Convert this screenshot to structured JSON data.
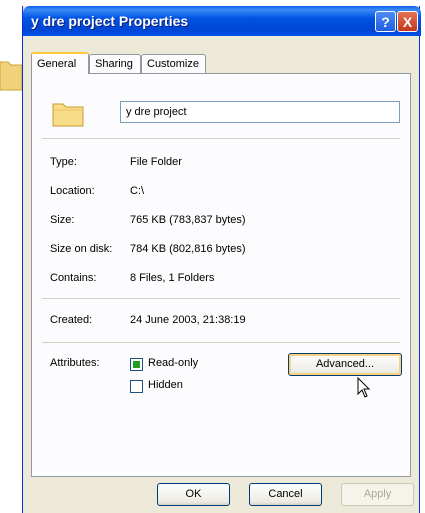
{
  "window": {
    "title": "y dre project Properties",
    "help_label": "?",
    "close_label": "X"
  },
  "tabs": [
    {
      "label": "General",
      "active": true
    },
    {
      "label": "Sharing",
      "active": false
    },
    {
      "label": "Customize",
      "active": false
    }
  ],
  "general": {
    "folder_name": "y dre project",
    "type_label": "Type:",
    "type_value": "File Folder",
    "location_label": "Location:",
    "location_value": "C:\\",
    "size_label": "Size:",
    "size_value": "765 KB (783,837 bytes)",
    "size_on_disk_label": "Size on disk:",
    "size_on_disk_value": "784 KB (802,816 bytes)",
    "contains_label": "Contains:",
    "contains_value": "8 Files, 1 Folders",
    "created_label": "Created:",
    "created_value": "24 June 2003, 21:38:19",
    "attributes_label": "Attributes:",
    "readonly_label": "Read-only",
    "readonly_checked": true,
    "hidden_label": "Hidden",
    "hidden_checked": false,
    "advanced_label": "Advanced..."
  },
  "footer": {
    "ok_label": "OK",
    "cancel_label": "Cancel",
    "apply_label": "Apply"
  },
  "colors": {
    "titlebar": "#0054e3",
    "face": "#ece9d8",
    "tab_highlight": "#ffc83c",
    "checkbox_mark": "#21a121"
  }
}
